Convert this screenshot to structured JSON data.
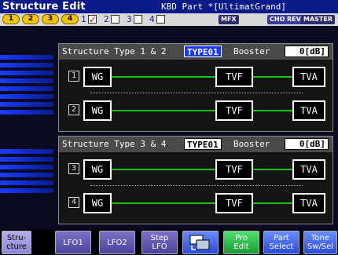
{
  "title": "Structure Edit",
  "part_info": "KBD Part *[UltimatGrand]",
  "tone_switches": [
    {
      "num": "1",
      "checked": true
    },
    {
      "num": "2",
      "checked": false
    },
    {
      "num": "3",
      "checked": false
    },
    {
      "num": "4",
      "checked": false
    }
  ],
  "tone_selects": [
    "1",
    "2",
    "3",
    "4"
  ],
  "fx_badges": [
    "MFX",
    "CHO",
    "REV",
    "MASTER"
  ],
  "panels": [
    {
      "label": "Structure Type 1 & 2",
      "type_value": "TYPE01",
      "selected": true,
      "booster_label": "Booster",
      "booster_value": "0[dB]",
      "lines": [
        {
          "num": "1",
          "blocks": [
            "WG",
            "TVF",
            "TVA"
          ]
        },
        {
          "num": "2",
          "blocks": [
            "WG",
            "TVF",
            "TVA"
          ]
        }
      ]
    },
    {
      "label": "Structure Type 3 & 4",
      "type_value": "TYPE01",
      "selected": false,
      "booster_label": "Booster",
      "booster_value": "0[dB]",
      "lines": [
        {
          "num": "3",
          "blocks": [
            "WG",
            "TVF",
            "TVA"
          ]
        },
        {
          "num": "4",
          "blocks": [
            "WG",
            "TVF",
            "TVA"
          ]
        }
      ]
    }
  ],
  "bottom_buttons": [
    {
      "label": "Stru-\ncture",
      "style": "active",
      "name": "structure-button"
    },
    {
      "label": "LFO1",
      "style": "purple",
      "name": "lfo1-button"
    },
    {
      "label": "LFO2",
      "style": "purple",
      "name": "lfo2-button"
    },
    {
      "label": "Step\nLFO",
      "style": "purple",
      "name": "step-lfo-button"
    },
    {
      "label": "",
      "style": "blue",
      "name": "zoom-button",
      "icon": "zoom-window-icon"
    },
    {
      "label": "Pro\nEdit",
      "style": "green",
      "name": "pro-edit-button"
    },
    {
      "label": "Part\nSelect",
      "style": "blue",
      "name": "part-select-button"
    },
    {
      "label": "Tone\nSw/Sel",
      "style": "blue",
      "name": "tone-sw-sel-button"
    }
  ],
  "colors": {
    "title_bar": "#0b1a8a",
    "wire": "#18c018",
    "selected_type": "#1a36ff",
    "tone_switch": "#f2c400"
  }
}
